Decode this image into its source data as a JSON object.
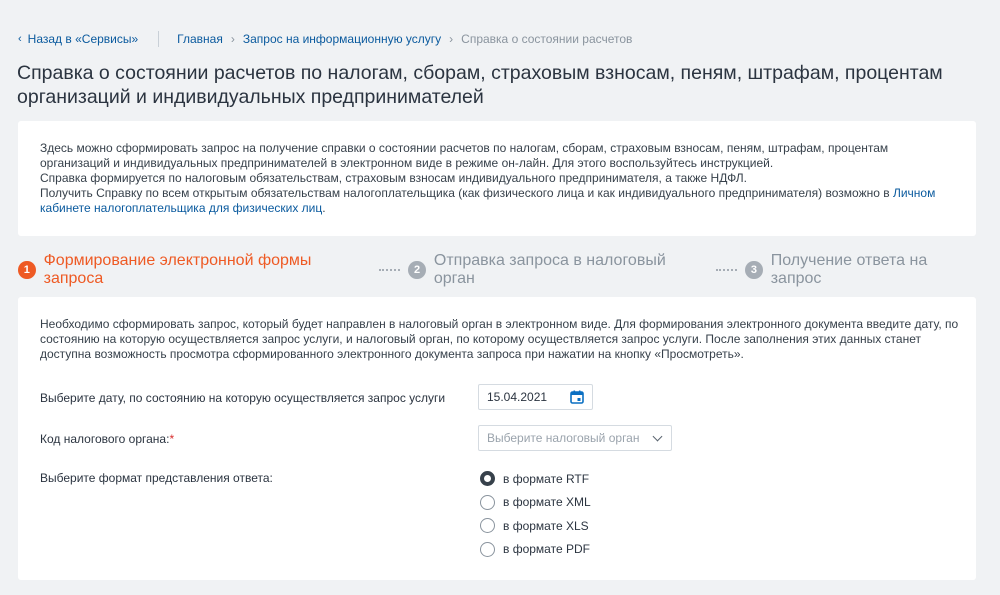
{
  "breadcrumbs": {
    "back_label": "Назад в «Сервисы»",
    "items": [
      "Главная",
      "Запрос на информационную услугу"
    ],
    "current": "Справка о состоянии расчетов"
  },
  "page_title": "Справка о состоянии расчетов по налогам, сборам, страховым взносам, пеням, штрафам, процентам организаций и индивидуальных предпринимателей",
  "info": {
    "line1": "Здесь можно сформировать запрос на получение справки о состоянии расчетов по налогам, сборам, страховым взносам, пеням, штрафам, процентам организаций и индивидуальных предпринимателей в электронном виде в режиме он-лайн. Для этого воспользуйтесь инструкцией.",
    "line2": "Справка формируется по налоговым обязательствам, страховым взносам индивидуального предпринимателя, а также НДФЛ.",
    "line3_prefix": "Получить Справку по всем открытым обязательствам налогоплательщика (как физического лица и как индивидуального предпринимателя) возможно в ",
    "line3_link": "Личном кабинете налогоплательщика для физических лиц",
    "line3_suffix": "."
  },
  "steps": [
    {
      "num": "1",
      "label": "Формирование электронной формы запроса",
      "state": "active"
    },
    {
      "num": "2",
      "label": "Отправка запроса в налоговый орган",
      "state": "inactive"
    },
    {
      "num": "3",
      "label": "Получение ответа на запрос",
      "state": "inactive"
    }
  ],
  "form": {
    "intro": "Необходимо сформировать запрос, который будет направлен в налоговый орган в электронном виде. Для формирования электронного документа введите дату, по состоянию на которую осуществляется запрос услуги, и налоговый орган, по которому осуществляется запрос услуги. После заполнения этих данных станет доступна возможность просмотра сформированного электронного документа запроса при нажатии на кнопку «Просмотреть».",
    "date_label": "Выберите дату, по состоянию на которую осуществляется запрос услуги",
    "date_value": "15.04.2021",
    "tax_label": "Код налогового органа:",
    "tax_required": "*",
    "tax_placeholder": "Выберите налоговый орган",
    "format_label": "Выберите формат представления ответа:",
    "formats": [
      "в формате RTF",
      "в формате XML",
      "в формате XLS",
      "в формате PDF"
    ],
    "selected_format": "в формате RTF"
  },
  "colors": {
    "accent": "#ee5a24",
    "link": "#0a5a9e",
    "inactive": "#a6adb5"
  }
}
